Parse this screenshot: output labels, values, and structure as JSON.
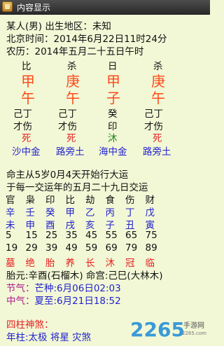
{
  "window": {
    "title": "内容显示"
  },
  "header": {
    "line1": "某人(男) 出生地区：未知",
    "line2": "北京时间：2014年6月22日11时24分",
    "line3": "农历：2014年五月二十五日午时"
  },
  "pillars": [
    {
      "shishen": "比",
      "gan": "甲",
      "zhi": "午",
      "cang1": "己丁",
      "cang2": "才伤",
      "state": "死",
      "nayin": "沙中金"
    },
    {
      "shishen": "杀",
      "gan": "庚",
      "zhi": "午",
      "cang1": "己丁",
      "cang2": "才伤",
      "state": "死",
      "nayin": "路旁土"
    },
    {
      "shishen": "日",
      "gan": "甲",
      "zhi": "子",
      "cang1": "癸",
      "cang2": "印",
      "state": "沐",
      "nayin": "海中金"
    },
    {
      "shishen": "杀",
      "gan": "庚",
      "zhi": "午",
      "cang1": "己丁",
      "cang2": "才伤",
      "state": "死",
      "nayin": "路旁土"
    }
  ],
  "dayun": {
    "intro1": "命主从5岁0月4天开始行大运",
    "intro2": "于每一交运年的五月二十九日交运",
    "shishen": [
      "官",
      "枭",
      "印",
      "比",
      "劫",
      "食",
      "伤",
      "财"
    ],
    "gan": [
      "辛",
      "壬",
      "癸",
      "甲",
      "乙",
      "丙",
      "丁",
      "戊"
    ],
    "zhi": [
      "未",
      "申",
      "酉",
      "戌",
      "亥",
      "子",
      "丑",
      "寅"
    ],
    "start": [
      "5",
      "15",
      "25",
      "35",
      "45",
      "55",
      "65",
      "75"
    ],
    "end": [
      "19",
      "29",
      "39",
      "49",
      "59",
      "69",
      "79",
      "89"
    ],
    "state": [
      "墓",
      "绝",
      "胎",
      "养",
      "长",
      "沐",
      "冠",
      "临"
    ]
  },
  "info": {
    "taiyuan": "胎元:辛酉(石榴木) 命宫:己巳(大林木)",
    "jieqi_label": "节气：",
    "jieqi_value": "芒种:6月06日02:03",
    "zhongqi_label": "中气：",
    "zhongqi_value": "夏至:6月21日18:52",
    "shensha_title": "四柱神煞：",
    "nianzhu": "年柱:太极 将星 灾煞"
  },
  "watermark": {
    "number": "2265",
    "site": "手游网",
    "url": "2265.com"
  },
  "colors": {
    "background": "#f2f8d6",
    "gan_zhi": "#ff4a1a",
    "blue_text": "#2222cc",
    "green_text": "#1a8a1a",
    "red_text": "#e52020",
    "magenta_text": "#b01a8a"
  }
}
